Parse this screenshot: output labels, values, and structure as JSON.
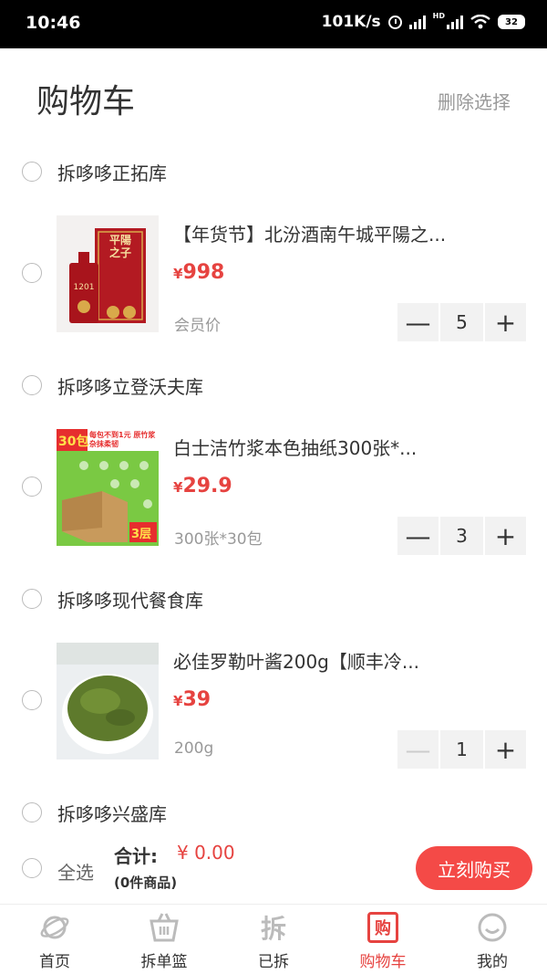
{
  "status_bar": {
    "time": "10:46",
    "net_speed": "101K/s",
    "hd_label": "HD",
    "battery": "32"
  },
  "header": {
    "title": "购物车",
    "delete_label": "删除选择"
  },
  "colors": {
    "accent": "#e64340",
    "button": "#f44a47"
  },
  "stores": [
    {
      "name": "拆哆哆正拓库",
      "items": [
        {
          "title": "【年货节】北汾酒南午城平陽之...",
          "currency": "¥",
          "price": "998",
          "spec": "会员价",
          "qty": "5",
          "image": "red-liquor-box",
          "image_text": "平陽之子",
          "image_sub": "1201"
        }
      ]
    },
    {
      "name": "拆哆哆立登沃夫库",
      "items": [
        {
          "title": "白士洁竹浆本色抽纸300张*...",
          "currency": "¥",
          "price": "29.9",
          "spec": "300张*30包",
          "qty": "3",
          "image": "tissue-box",
          "image_text": "30包",
          "image_badge": "3层",
          "image_banner": "每包不到1元 原竹浆杂抹柔韧"
        }
      ]
    },
    {
      "name": "拆哆哆现代餐食库",
      "items": [
        {
          "title": "必佳罗勒叶酱200g【顺丰冷...",
          "currency": "¥",
          "price": "39",
          "spec": "200g",
          "qty": "1",
          "image": "pesto-bowl"
        }
      ]
    },
    {
      "name": "拆哆哆兴盛库",
      "items": []
    }
  ],
  "summary": {
    "select_all": "全选",
    "total_label": "合计:",
    "total_value": "¥ 0.00",
    "count_label": "(0件商品)",
    "buy_label": "立刻购买"
  },
  "tabs": [
    {
      "label": "首页",
      "icon": "planet-icon"
    },
    {
      "label": "拆单篮",
      "icon": "basket-icon"
    },
    {
      "label": "已拆",
      "icon": "chai-icon",
      "glyph": "拆"
    },
    {
      "label": "购物车",
      "icon": "cart-icon",
      "glyph": "购",
      "active": true
    },
    {
      "label": "我的",
      "icon": "smile-icon"
    }
  ]
}
